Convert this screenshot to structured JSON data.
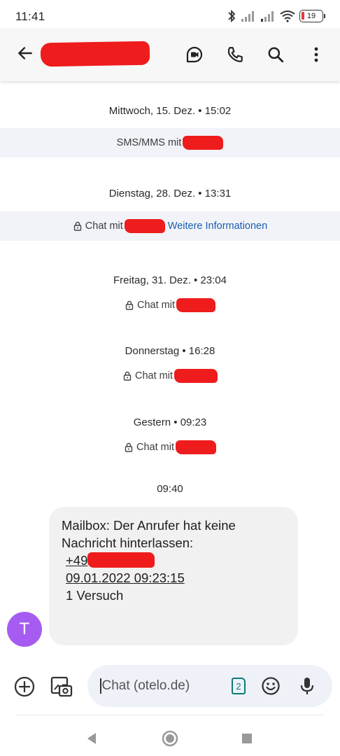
{
  "status_bar": {
    "time": "11:41",
    "battery": "19"
  },
  "header": {
    "back_icon": "arrow-left-icon"
  },
  "timeline": [
    {
      "date": "Mittwoch, 15. Dez. • 15:02",
      "info": "SMS/MMS mit"
    },
    {
      "date": "Dienstag, 28. Dez. • 13:31",
      "info": "Chat mit",
      "link": "Weitere Informationen"
    },
    {
      "date": "Freitag, 31. Dez. • 23:04",
      "info": "Chat mit"
    },
    {
      "date": "Donnerstag • 16:28",
      "info": "Chat mit"
    },
    {
      "date": "Gestern • 09:23",
      "info": "Chat mit"
    }
  ],
  "message": {
    "time": "09:40",
    "avatar_letter": "T",
    "line1": "Mailbox: Der Anrufer hat keine",
    "line2": "Nachricht hinterlassen:",
    "phone_prefix": "+49",
    "datetime": "09.01.2022 09:23:15",
    "attempts": "1 Versuch"
  },
  "compose": {
    "placeholder": "Chat (otelo.de)",
    "sim": "2"
  },
  "colors": {
    "redaction": "#ee1c1c",
    "avatar": "#a65cf0",
    "link": "#1a5fb4",
    "sim": "#0c7c73"
  }
}
